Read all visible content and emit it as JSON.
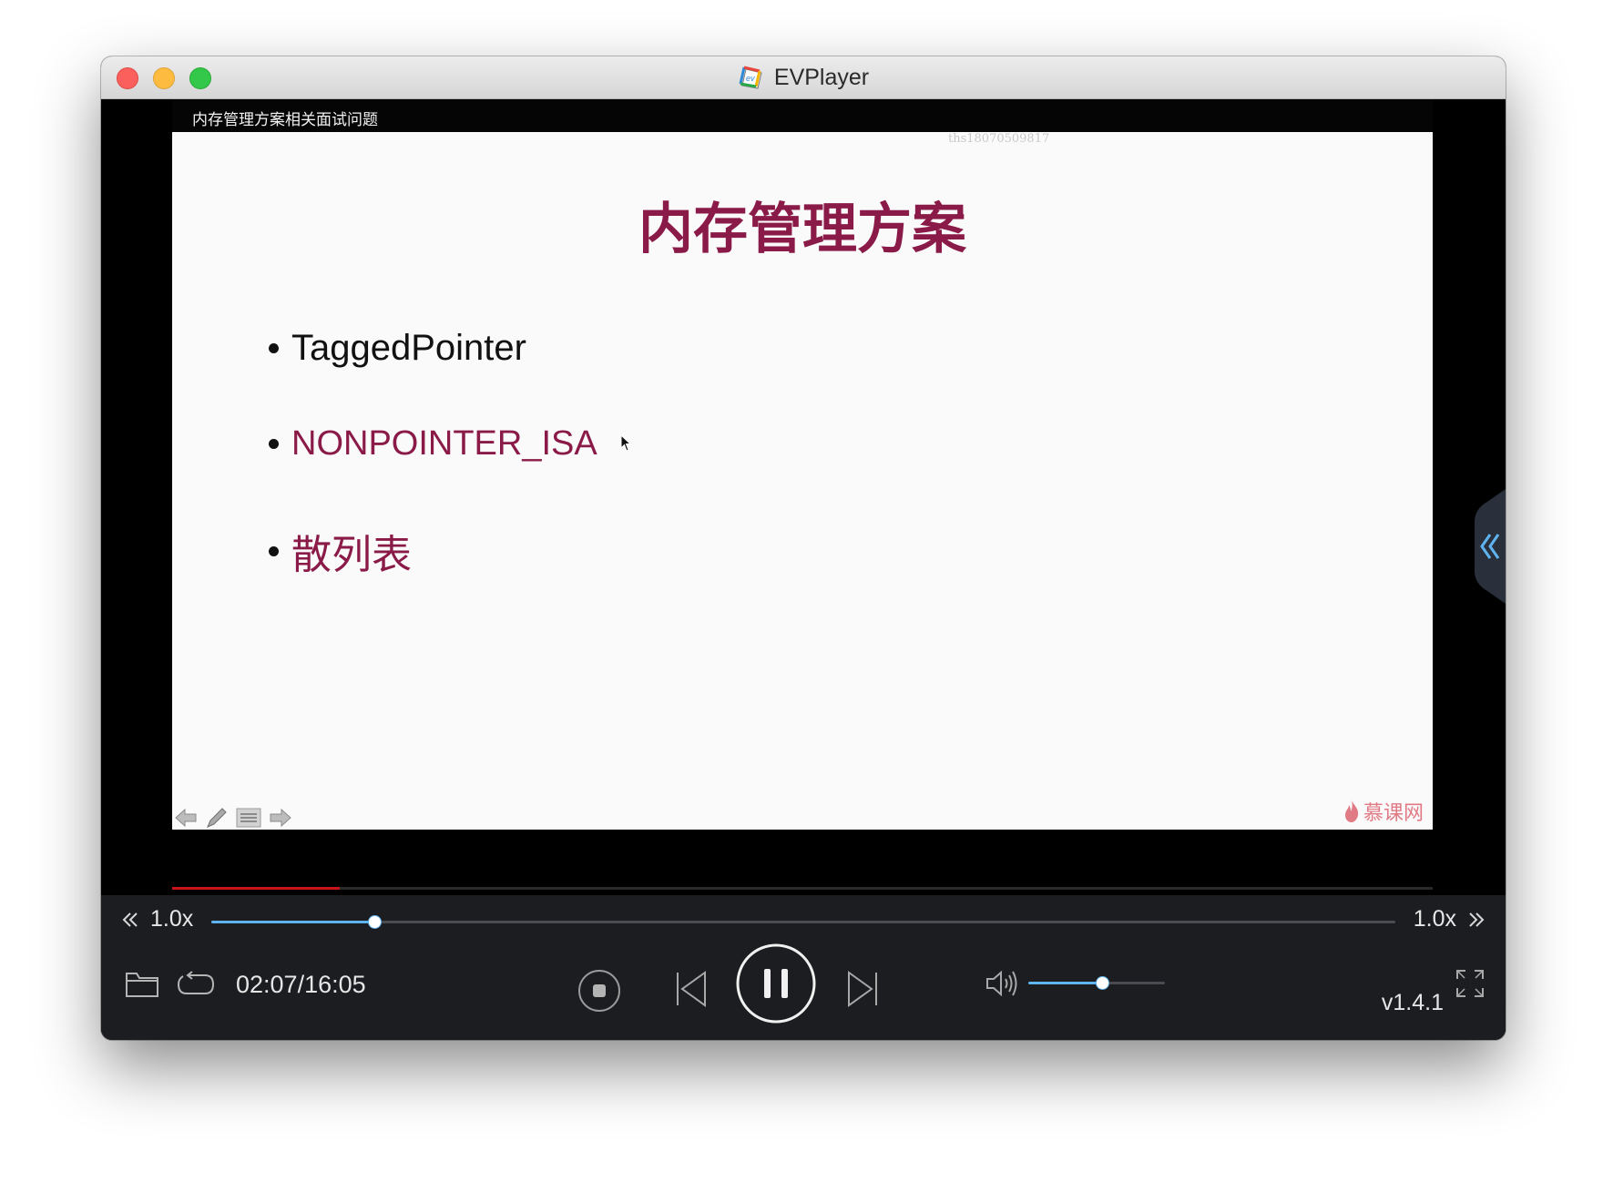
{
  "window": {
    "title": "EVPlayer"
  },
  "video": {
    "title": "内存管理方案相关面试问题",
    "watermark_user": "ths18070509817",
    "progress_fraction": 0.133
  },
  "slide": {
    "title": "内存管理方案",
    "bullets": [
      "TaggedPointer",
      "NONPOINTER_ISA",
      "散列表"
    ],
    "brand": "慕课网"
  },
  "controls": {
    "speed_left": "1.0x",
    "speed_right": "1.0x",
    "speed_fraction": 0.138,
    "time": "02:07/16:05",
    "volume_fraction": 0.54,
    "version": "v1.4.1"
  },
  "colors": {
    "accent": "#5fb4f0",
    "slide_title": "#8a1a47",
    "video_progress": "#c8151b"
  }
}
